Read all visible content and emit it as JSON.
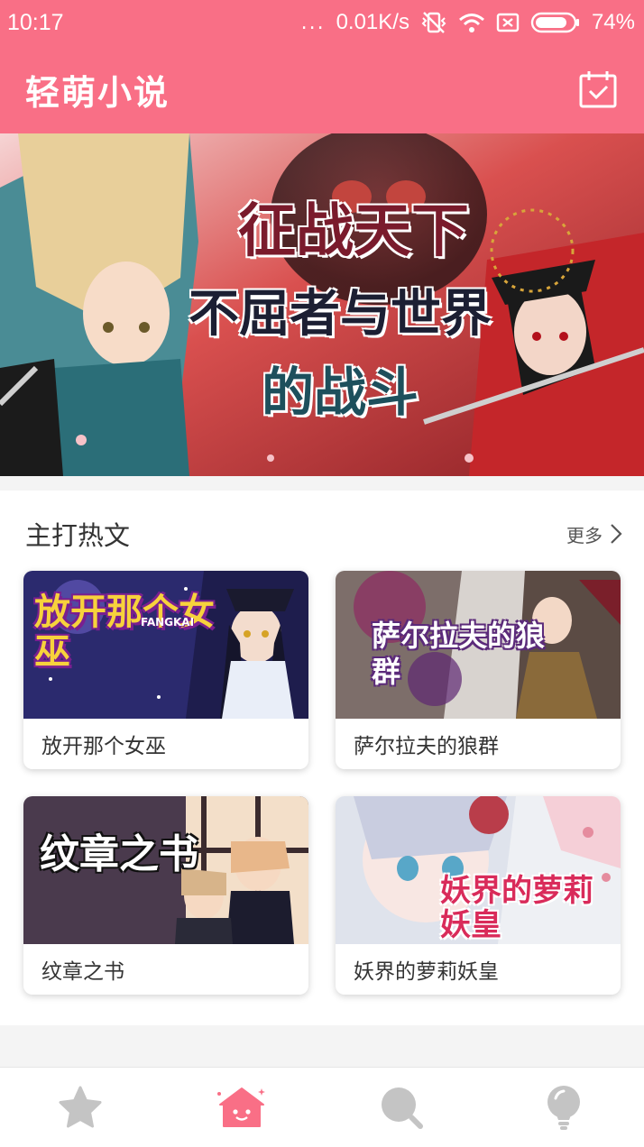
{
  "status_bar": {
    "time": "10:17",
    "dots": "...",
    "speed": "0.01K/s",
    "battery": "74%"
  },
  "app_bar": {
    "title": "轻萌小说",
    "checkin_icon": "calendar-check-icon"
  },
  "banner": {
    "line1": "征战天下",
    "line2": "不屈者与世界",
    "line3": "的战斗"
  },
  "hot_section": {
    "title": "主打热文",
    "more_label": "更多",
    "books": [
      {
        "title": "放开那个女巫",
        "cover_text": "放开那个女巫",
        "cover_sub": "FANGKAI"
      },
      {
        "title": "萨尔拉夫的狼群",
        "cover_text": "萨尔拉夫的狼群"
      },
      {
        "title": "纹章之书",
        "cover_text": "纹章之书"
      },
      {
        "title": "妖界的萝莉妖皇",
        "cover_text": "妖界的萝莉妖皇"
      }
    ]
  },
  "bottom_nav": {
    "items": [
      {
        "icon": "star-icon",
        "active": false
      },
      {
        "icon": "home-icon",
        "active": true
      },
      {
        "icon": "search-icon",
        "active": false
      },
      {
        "icon": "lightbulb-icon",
        "active": false
      }
    ]
  },
  "colors": {
    "brand": "#f96f86",
    "nav_inactive": "#c4c4c4"
  }
}
